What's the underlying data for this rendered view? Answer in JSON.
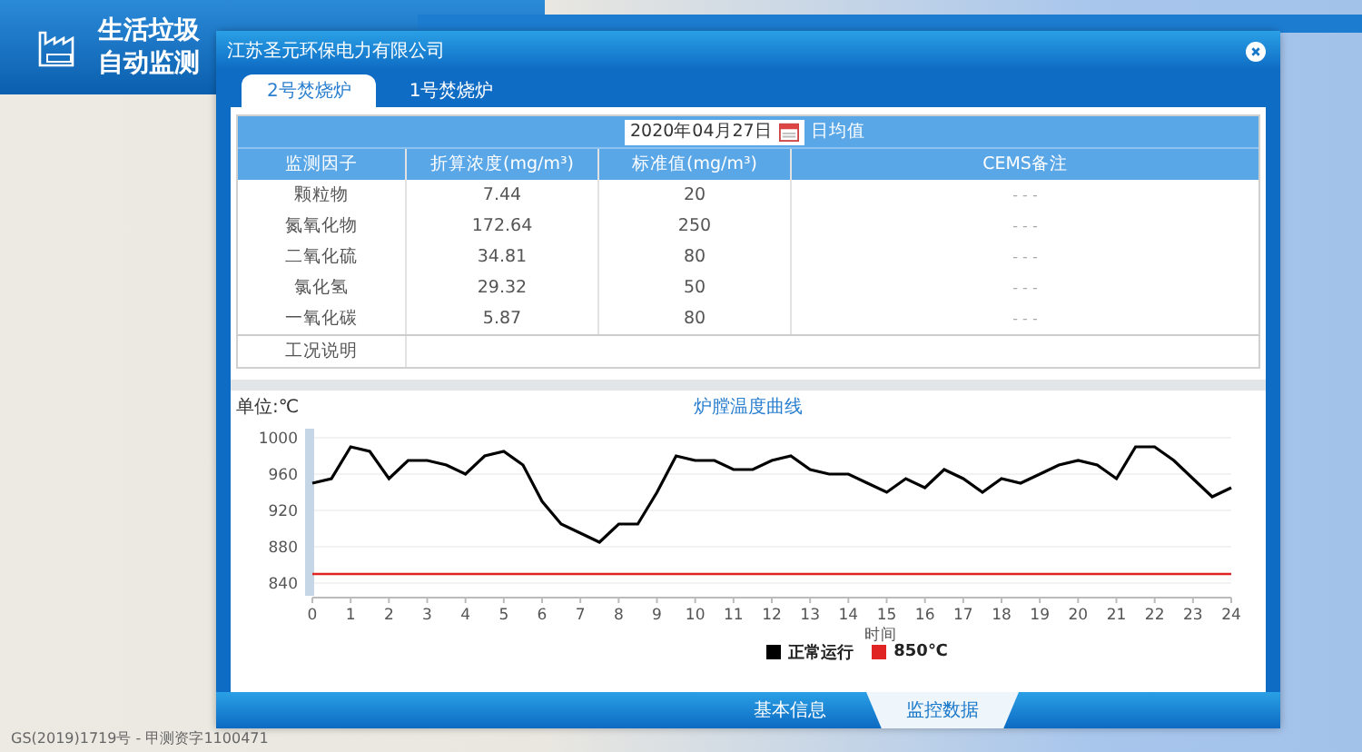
{
  "header": {
    "title_lines": [
      "生活垃圾",
      "自动监测"
    ]
  },
  "dialog": {
    "title": "江苏圣元环保电力有限公司",
    "tabs": [
      {
        "label": "2号焚烧炉",
        "selected": true
      },
      {
        "label": "1号焚烧炉",
        "selected": false
      }
    ],
    "date": {
      "value": "2020年04月27日",
      "mode": "日均值"
    },
    "table": {
      "columns": [
        "监测因子",
        "折算浓度(mg/m³)",
        "标准值(mg/m³)",
        "CEMS备注"
      ],
      "rows": [
        {
          "factor": "颗粒物",
          "concentration": "7.44",
          "standard": "20",
          "cems_note": "- - -"
        },
        {
          "factor": "氮氧化物",
          "concentration": "172.64",
          "standard": "250",
          "cems_note": "- - -"
        },
        {
          "factor": "二氧化硫",
          "concentration": "34.81",
          "standard": "80",
          "cems_note": "- - -"
        },
        {
          "factor": "氯化氢",
          "concentration": "29.32",
          "standard": "50",
          "cems_note": "- - -"
        },
        {
          "factor": "一氧化碳",
          "concentration": "5.87",
          "standard": "80",
          "cems_note": "- - -"
        }
      ],
      "remarks_label": "工况说明"
    },
    "chart": {
      "unit": "单位:℃",
      "chart_data": {
        "type": "line",
        "title": "炉膛温度曲线",
        "xlabel": "时间",
        "x": [
          0,
          0.5,
          1,
          1.5,
          2,
          2.5,
          3,
          3.5,
          4,
          4.5,
          5,
          5.5,
          6,
          6.5,
          7,
          7.5,
          8,
          8.5,
          9,
          9.5,
          10,
          10.5,
          11,
          11.5,
          12,
          12.5,
          13,
          13.5,
          14,
          14.5,
          15,
          15.5,
          16,
          16.5,
          17,
          17.5,
          18,
          18.5,
          19,
          19.5,
          20,
          20.5,
          21,
          21.5,
          22,
          22.5,
          23,
          23.5,
          24
        ],
        "series": [
          {
            "name": "正常运行",
            "color": "#000000",
            "values": [
              950,
              955,
              990,
              985,
              955,
              975,
              975,
              970,
              960,
              980,
              985,
              970,
              930,
              905,
              895,
              885,
              905,
              905,
              940,
              980,
              975,
              975,
              965,
              965,
              975,
              980,
              965,
              960,
              960,
              950,
              940,
              955,
              945,
              965,
              955,
              940,
              955,
              950,
              960,
              970,
              975,
              970,
              955,
              990,
              990,
              975,
              955,
              935,
              945
            ]
          },
          {
            "name": "850℃",
            "color": "#e02424",
            "values": [
              850,
              850,
              850,
              850,
              850,
              850,
              850,
              850,
              850,
              850,
              850,
              850,
              850,
              850,
              850,
              850,
              850,
              850,
              850,
              850,
              850,
              850,
              850,
              850,
              850,
              850,
              850,
              850,
              850,
              850,
              850,
              850,
              850,
              850,
              850,
              850,
              850,
              850,
              850,
              850,
              850,
              850,
              850,
              850,
              850,
              850,
              850,
              850,
              850
            ]
          }
        ],
        "xticks": [
          0,
          1,
          2,
          3,
          4,
          5,
          6,
          7,
          8,
          9,
          10,
          11,
          12,
          13,
          14,
          15,
          16,
          17,
          18,
          19,
          20,
          21,
          22,
          23,
          24
        ],
        "yticks": [
          840,
          880,
          920,
          960,
          1000
        ],
        "grid": true,
        "ylim": [
          840,
          1000
        ],
        "xlim": [
          0,
          24
        ]
      }
    },
    "bottom_tabs": [
      {
        "label": "基本信息",
        "selected": false
      },
      {
        "label": "监控数据",
        "selected": true
      }
    ]
  },
  "map_attribution": "GS(2019)1719号 - 甲测资字1100471"
}
